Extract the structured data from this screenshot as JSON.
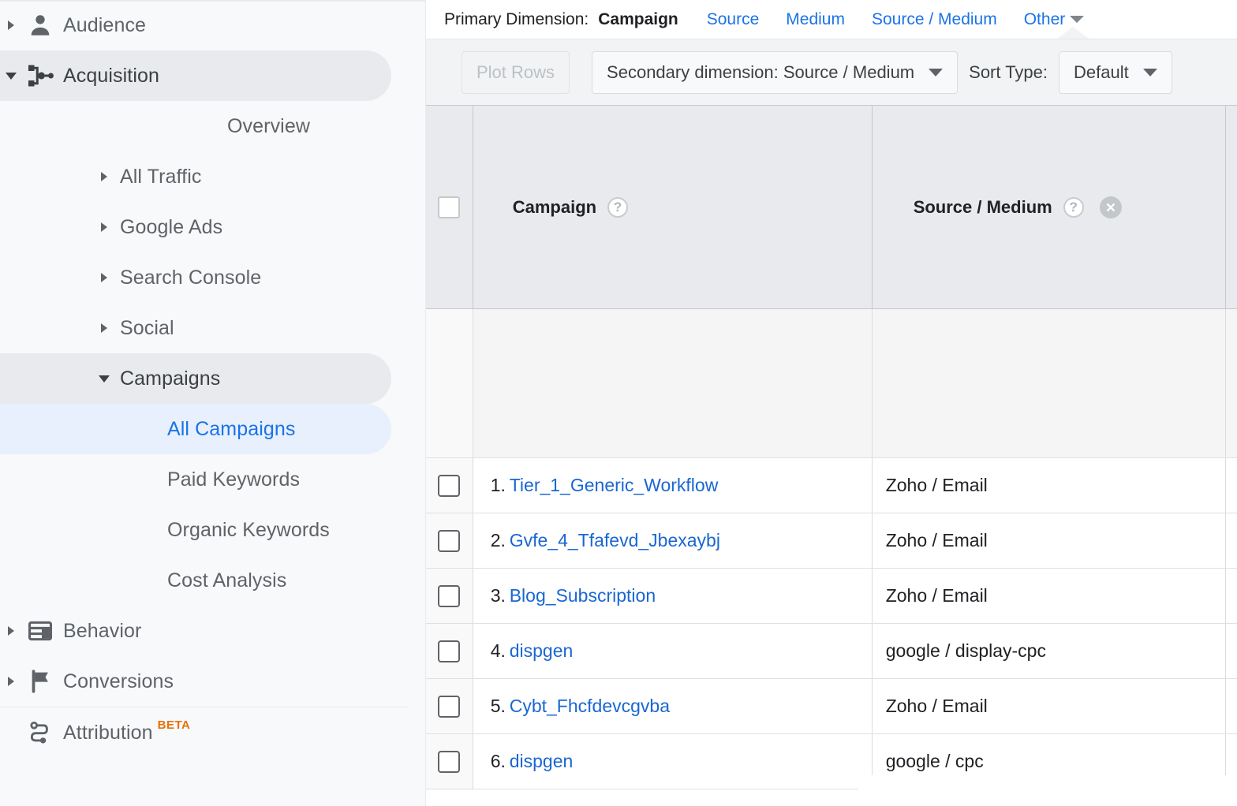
{
  "sidebar": {
    "items": [
      {
        "label": "Audience",
        "icon": "person-icon",
        "level": 0,
        "expander": "collapsed",
        "state": "normal"
      },
      {
        "label": "Acquisition",
        "icon": "acquisition-icon",
        "level": 0,
        "expander": "expanded",
        "state": "group-selected"
      },
      {
        "label": "Overview",
        "icon": "",
        "level": 1,
        "expander": "none",
        "state": "normal"
      },
      {
        "label": "All Traffic",
        "icon": "",
        "level": 1,
        "expander": "collapsed",
        "state": "normal"
      },
      {
        "label": "Google Ads",
        "icon": "",
        "level": 1,
        "expander": "collapsed",
        "state": "normal"
      },
      {
        "label": "Search Console",
        "icon": "",
        "level": 1,
        "expander": "collapsed",
        "state": "normal"
      },
      {
        "label": "Social",
        "icon": "",
        "level": 1,
        "expander": "collapsed",
        "state": "normal"
      },
      {
        "label": "Campaigns",
        "icon": "",
        "level": 1,
        "expander": "expanded",
        "state": "group-selected"
      },
      {
        "label": "All Campaigns",
        "icon": "",
        "level": 2,
        "expander": "none",
        "state": "active"
      },
      {
        "label": "Paid Keywords",
        "icon": "",
        "level": 2,
        "expander": "none",
        "state": "normal"
      },
      {
        "label": "Organic Keywords",
        "icon": "",
        "level": 2,
        "expander": "none",
        "state": "normal"
      },
      {
        "label": "Cost Analysis",
        "icon": "",
        "level": 2,
        "expander": "none",
        "state": "normal"
      },
      {
        "label": "Behavior",
        "icon": "behavior-icon",
        "level": 0,
        "expander": "collapsed",
        "state": "normal"
      },
      {
        "label": "Conversions",
        "icon": "flag-icon",
        "level": 0,
        "expander": "collapsed",
        "state": "normal"
      },
      {
        "label": "Attribution",
        "icon": "attribution-icon",
        "level": 0,
        "expander": "none",
        "state": "normal",
        "badge": "BETA"
      }
    ],
    "accent_active_bg": "#e8f0fe",
    "accent_active_text": "#1a73e8",
    "group_selected_bg": "#e8eaed",
    "badge_color": "#e8710a"
  },
  "primary_dimension": {
    "label": "Primary Dimension:",
    "options": [
      {
        "label": "Campaign",
        "selected": true
      },
      {
        "label": "Source",
        "selected": false
      },
      {
        "label": "Medium",
        "selected": false
      },
      {
        "label": "Source / Medium",
        "selected": false
      },
      {
        "label": "Other",
        "selected": false,
        "has_caret": true
      }
    ]
  },
  "toolbar": {
    "plot_rows_label": "Plot Rows",
    "plot_rows_disabled": true,
    "secondary_dimension_label": "Secondary dimension: Source / Medium",
    "sort_type_label": "Sort Type:",
    "sort_type_value": "Default"
  },
  "table": {
    "columns": [
      {
        "key": "checkbox",
        "header": "",
        "help": false,
        "removable": false
      },
      {
        "key": "campaign",
        "header": "Campaign",
        "help": true,
        "removable": false
      },
      {
        "key": "source_medium",
        "header": "Source / Medium",
        "help": true,
        "removable": true
      }
    ],
    "help_glyph": "?",
    "rows": [
      {
        "num": "1.",
        "campaign": "Tier_1_Generic_Workflow",
        "source_medium": "Zoho / Email"
      },
      {
        "num": "2.",
        "campaign": "Gvfe_4_Tfafevd_Jbexaybj",
        "source_medium": "Zoho / Email"
      },
      {
        "num": "3.",
        "campaign": "Blog_Subscription",
        "source_medium": "Zoho / Email"
      },
      {
        "num": "4.",
        "campaign": "dispgen",
        "source_medium": "google / display-cpc"
      },
      {
        "num": "5.",
        "campaign": "Cybt_Fhcfdevcgvba",
        "source_medium": "Zoho / Email"
      },
      {
        "num": "6.",
        "campaign": "dispgen",
        "source_medium": "google / cpc"
      }
    ],
    "totals_row": {
      "campaign": "",
      "source_medium": ""
    },
    "link_color": "#1967d2",
    "header_bg": "#e8eaed"
  }
}
